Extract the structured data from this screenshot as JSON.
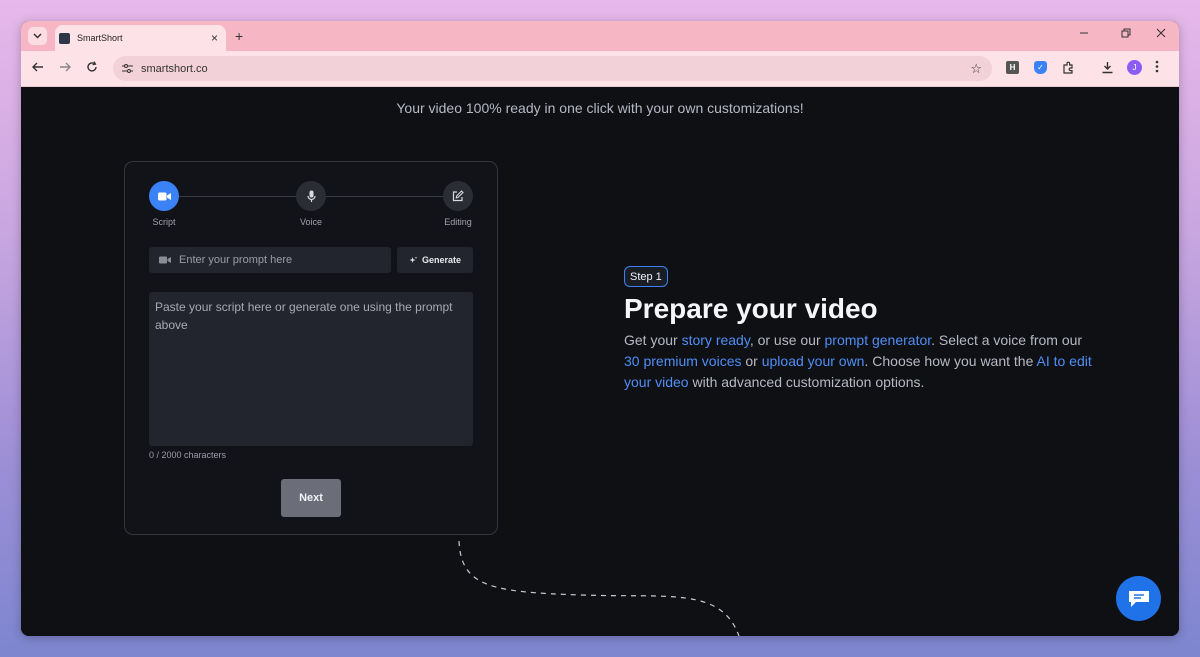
{
  "browser": {
    "tab_title": "SmartShort",
    "url": "smartshort.co",
    "profile_initial": "J",
    "extension_h": "H"
  },
  "page": {
    "headline": "Your video 100% ready in one click with your own customizations!",
    "stepper": [
      {
        "label": "Script",
        "icon": "video-icon",
        "active": true
      },
      {
        "label": "Voice",
        "icon": "microphone-icon",
        "active": false
      },
      {
        "label": "Editing",
        "icon": "edit-icon",
        "active": false
      }
    ],
    "prompt_placeholder": "Enter your prompt here",
    "generate_label": "Generate",
    "script_placeholder": "Paste your script here or generate one using the prompt above",
    "char_count": "0 / 2000 characters",
    "next_label": "Next",
    "step_badge": "Step 1",
    "section_title": "Prepare your video",
    "description": {
      "t1": "Get your ",
      "l1": "story ready",
      "t2": ", or use our ",
      "l2": "prompt generator",
      "t3": ". Select a voice from our ",
      "l3": "30 premium voices",
      "t4": " or ",
      "l4": "upload your own",
      "t5": ". Choose how you want the ",
      "l5": "AI to edit your video",
      "t6": " with advanced customization options."
    }
  },
  "colors": {
    "accent": "#3b82f6",
    "link": "#4f8ef7",
    "page_bg": "#0f1014",
    "tab_bar": "#f7b6c4"
  }
}
